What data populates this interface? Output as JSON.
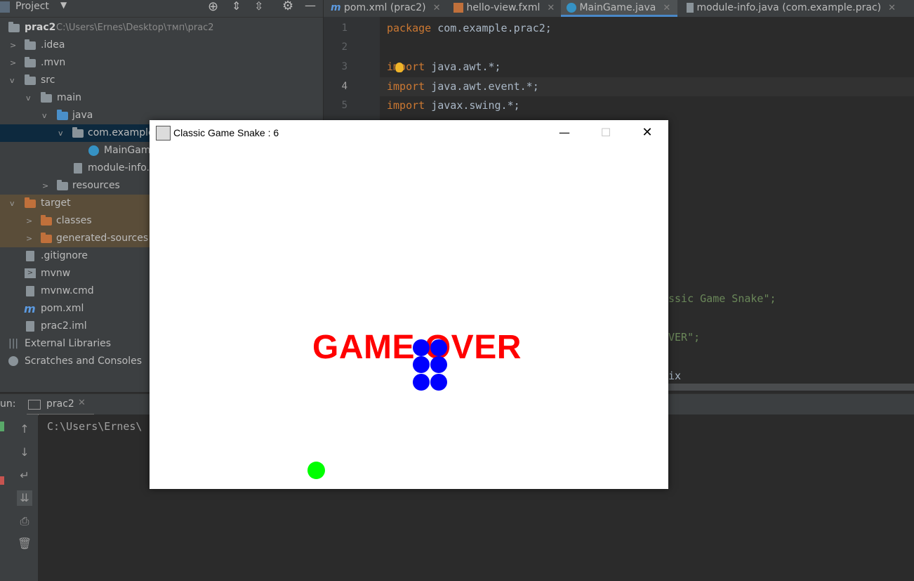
{
  "project": {
    "title": "Project",
    "tree": [
      {
        "label": "prac2",
        "path": "C:\\Users\\Ernes\\Desktop\\тмп\\prac2"
      },
      {
        "label": ".idea"
      },
      {
        "label": ".mvn"
      },
      {
        "label": "src"
      },
      {
        "label": "main"
      },
      {
        "label": "java"
      },
      {
        "label": "com.example"
      },
      {
        "label": "MainGam"
      },
      {
        "label": "module-info."
      },
      {
        "label": "resources"
      },
      {
        "label": "target"
      },
      {
        "label": "classes"
      },
      {
        "label": "generated-sources"
      },
      {
        "label": ".gitignore"
      },
      {
        "label": "mvnw"
      },
      {
        "label": "mvnw.cmd"
      },
      {
        "label": "pom.xml"
      },
      {
        "label": "prac2.iml"
      },
      {
        "label": "External Libraries"
      },
      {
        "label": "Scratches and Consoles"
      }
    ]
  },
  "tabs": [
    {
      "label": "pom.xml (prac2)"
    },
    {
      "label": "hello-view.fxml"
    },
    {
      "label": "MainGame.java"
    },
    {
      "label": "module-info.java (com.example.prac)"
    }
  ],
  "editor": {
    "line_numbers": [
      "1",
      "2",
      "3",
      "4",
      "5"
    ],
    "code": {
      "l1_kw": "package",
      "l1_rest": " com.example.prac2;",
      "l3_kw": "import",
      "l3_rest": " java.awt.*;",
      "l4_kw": "import",
      "l4_rest": " java.awt.event.*;",
      "l5_kw": "import",
      "l5_rest": " javax.swing.*;",
      "frag1": "ssic Game Snake\";",
      "frag2": "VER\";",
      "frag3": "ix"
    }
  },
  "run": {
    "label": "un:",
    "config": "prac2",
    "console_text": "C:\\Users\\Ernes\\"
  },
  "game": {
    "window_title": "Classic Game Snake : 6",
    "message": "GAME OVER",
    "colors": {
      "message": "#ff0000",
      "snake": "#0000ff",
      "food": "#00ff00"
    },
    "snake_segments": 6
  }
}
